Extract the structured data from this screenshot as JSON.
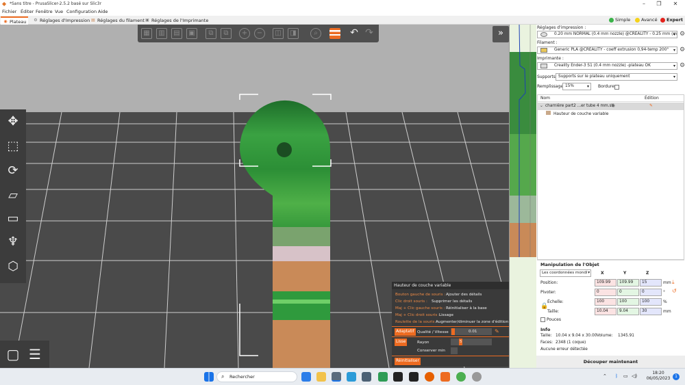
{
  "window": {
    "title": "*Sans titre - PrusaSlicer-2.5.2 basé sur Slic3r",
    "controls": [
      "–",
      "❐",
      "✕"
    ]
  },
  "menu": [
    "Fichier",
    "Éditer",
    "Fenêtre",
    "Vue",
    "Configuration",
    "Aide"
  ],
  "tabs": [
    "Plateau",
    "Réglages d'Impression",
    "Réglages du filament",
    "Réglages de l'Imprimante"
  ],
  "modes": [
    {
      "label": "Simple",
      "color": "#3bb34a"
    },
    {
      "label": "Avancé",
      "color": "#f5d21a"
    },
    {
      "label": "Expert",
      "color": "#e3231c"
    }
  ],
  "layer_height_panel": {
    "title": "Hauteur de couche variable",
    "hints": [
      {
        "key": "Bouton gauche de souris :",
        "value": "Ajouter des détails"
      },
      {
        "key": "Clic droit souris :",
        "value": "Supprimer les détails"
      },
      {
        "key": "Maj + Clic gauche souris :",
        "value": "Réinitialiser à la base"
      },
      {
        "key": "Maj + Clic droit souris :",
        "value": "Lissage"
      },
      {
        "key": "Roulette de la souris :",
        "value": "Augmenter/diminuer la zone d'édition"
      }
    ],
    "adaptive_btn": "Adaptatif",
    "quality_label": "Qualité / Vitesse",
    "quality_value": "0.01",
    "smooth_btn": "Lisse",
    "radius_label": "Rayon",
    "radius_value": "5",
    "keep_min_label": "Conserver min",
    "reset_btn": "Réinitialiser"
  },
  "sidebar": {
    "print_settings_label": "Réglages d'impression :",
    "print_settings_value": "0.20 mm NORMAL (0.4 mm nozzle) @CREALITY - 0.25 mm (m",
    "filament_label": "Filament :",
    "filament_value": "Generic PLA @CREALITY - coeff extrusion 0,94-temp 200°",
    "printer_label": "Imprimante :",
    "printer_value": "Creality Ender-3 S1 (0.4 mm nozzle) -plateau OK",
    "supports_label": "Supports:",
    "supports_value": "Supports sur le plateau uniquement",
    "infill_label": "Remplissage:",
    "infill_value": "15%",
    "brim_label": "Bordure:",
    "list_header_name": "Nom",
    "list_header_edit": "Édition",
    "object_name": "charnière part2 ...er tube 4 mm.stl",
    "object_child": "Hauteur de couche variable",
    "manip_title": "Manipulation de l'Objet",
    "coord_value": "Les coordonnées mondi",
    "axis_x": "X",
    "axis_y": "Y",
    "axis_z": "Z",
    "position_label": "Position:",
    "position": [
      "109.99",
      "109.99",
      "15"
    ],
    "position_unit": "mm",
    "rotate_label": "Pivoter:",
    "rotate": [
      "0",
      "0",
      "0"
    ],
    "rotate_unit": "°",
    "scale_label": "Échelle:",
    "scale": [
      "100",
      "100",
      "100"
    ],
    "scale_unit": "%",
    "size_label": "Taille:",
    "size": [
      "10.04",
      "9.04",
      "30"
    ],
    "size_unit": "mm",
    "inches_label": "Pouces",
    "info_title": "Info",
    "info_size_label": "Taille:",
    "info_size": "10.04 x 9.04 x 30.00",
    "info_volume_label": "Volume:",
    "info_volume": "1345.91",
    "info_faces_label": "Faces:",
    "info_faces": "2348 (1 coque)",
    "info_errors": "Aucune erreur détectée",
    "slice_btn": "Découper maintenant"
  },
  "taskbar": {
    "search": "Rechercher",
    "time": "18:20",
    "date": "06/05/2023",
    "notif_count": "1"
  },
  "colors": {
    "accent": "#ed6b21",
    "model_green": "#2e9a3a",
    "model_tan": "#c98a58",
    "floor": "#4a4a4a",
    "sky": "#b0b0b0"
  }
}
